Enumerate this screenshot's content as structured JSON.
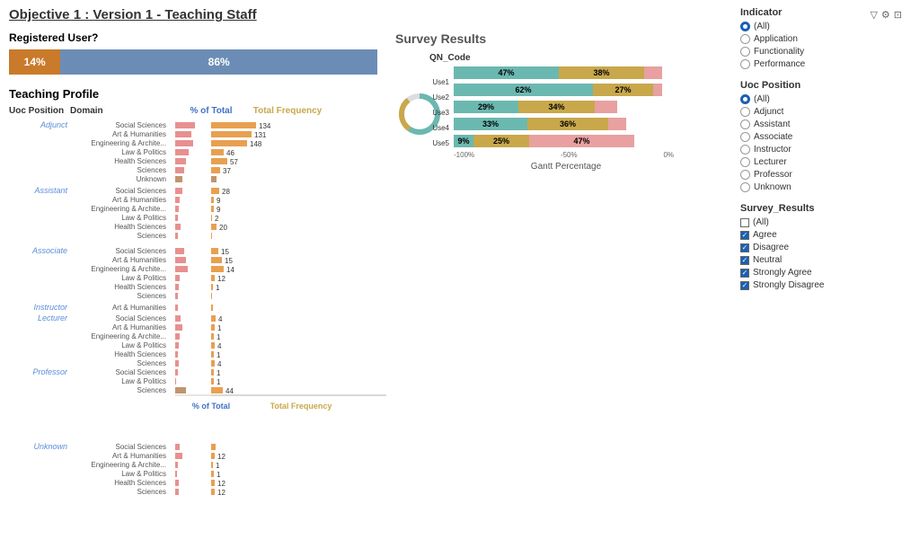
{
  "title": "Objective 1 : Version 1 - Teaching Staff",
  "registered_user": {
    "label": "Registered User?",
    "no_pct": "14%",
    "yes_pct": "86%"
  },
  "teaching_profile": {
    "label": "Teaching Profile",
    "col_headers": [
      "Uoc Position",
      "Domain",
      "% of Total",
      "Total Frequency"
    ],
    "positions": [
      {
        "name": "Adjunct",
        "domains": [
          "Social Sciences",
          "Art & Humanities",
          "Engineering & Archite...",
          "Law & Politics",
          "Health Sciences",
          "Sciences",
          "Unknown"
        ]
      },
      {
        "name": "Assistant",
        "domains": [
          "Social Sciences",
          "Art & Humanities",
          "Engineering & Archite...",
          "Law & Politics",
          "Health Sciences",
          "Sciences"
        ]
      },
      {
        "name": "Associate",
        "domains": [
          "Social Sciences",
          "Art & Humanities",
          "Engineering & Archite...",
          "Law & Politics",
          "Health Sciences",
          "Sciences"
        ]
      },
      {
        "name": "Instructor",
        "domains": [
          "Art & Humanities"
        ]
      },
      {
        "name": "Lecturer",
        "domains": [
          "Social Sciences",
          "Art & Humanities",
          "Engineering & Archite...",
          "Law & Politics",
          "Health Sciences",
          "Sciences"
        ]
      },
      {
        "name": "Professor",
        "domains": [
          "Social Sciences",
          "Law & Politics",
          "Sciences"
        ]
      },
      {
        "name": "Unknown",
        "domains": [
          "Social Sciences",
          "Art & Humanities",
          "Engineering & Archite...",
          "Law & Politics",
          "Health Sciences",
          "Sciences"
        ]
      }
    ]
  },
  "survey_results": {
    "label": "Survey Results",
    "qn_code_label": "QN_Code",
    "rows": [
      {
        "label": "Use1",
        "teal": 47,
        "gold": 38
      },
      {
        "label": "Use2",
        "teal": 62,
        "gold": 27
      },
      {
        "label": "Use3",
        "teal": 29,
        "gold": 34
      },
      {
        "label": "Use4",
        "teal": 33,
        "gold": 36
      },
      {
        "label": "Use5",
        "teal": 9,
        "gold": 25,
        "extra": 47
      }
    ],
    "x_labels": [
      "-100%",
      "-50%",
      "0%"
    ],
    "gantt_label": "Gantt Percentage"
  },
  "indicator": {
    "label": "Indicator",
    "options": [
      {
        "value": "(All)",
        "selected": true
      },
      {
        "value": "Application",
        "selected": false
      },
      {
        "value": "Functionality",
        "selected": false
      },
      {
        "value": "Performance",
        "selected": false
      }
    ]
  },
  "uoc_position": {
    "label": "Uoc Position",
    "options": [
      {
        "value": "(All)",
        "selected": true
      },
      {
        "value": "Adjunct",
        "selected": false
      },
      {
        "value": "Assistant",
        "selected": false
      },
      {
        "value": "Associate",
        "selected": false
      },
      {
        "value": "Instructor",
        "selected": false
      },
      {
        "value": "Lecturer",
        "selected": false
      },
      {
        "value": "Professor",
        "selected": false
      },
      {
        "value": "Unknown",
        "selected": false
      }
    ]
  },
  "survey_results_filter": {
    "label": "Survey_Results",
    "options": [
      {
        "value": "(All)",
        "checked": false
      },
      {
        "value": "Agree",
        "checked": true
      },
      {
        "value": "Disagree",
        "checked": true
      },
      {
        "value": "Neutral",
        "checked": true
      },
      {
        "value": "Strongly Agree",
        "checked": true
      },
      {
        "value": "Strongly Disagree",
        "checked": true
      }
    ]
  }
}
